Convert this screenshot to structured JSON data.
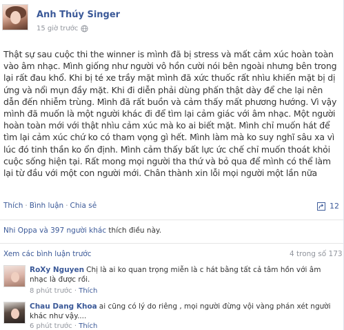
{
  "post": {
    "author": "Anh Thúy Singer",
    "timestamp": "15 giờ trước",
    "text": "Thật sự sau cuộc thi the winner is mình đã bị stress và mất cảm xúc hoàn toàn vào âm nhạc. Mình giống như người vô hồn cười nói bên ngoài nhưng bên trong lại rất đau khổ. Khi bị té xe trầy mặt mình đã xức thuốc rất nhìu khiến mặt bị dị ứng và nổi mụn đầy mặt. Khi đi diễn phải dùng phấn thật dày để che lại nên dẫn đến nhiễm trùng. Mình đã rất buồn và cảm thấy mất phương hướng. Vì vậy mình đã muốn là một người khác đi để tìm lại cảm giác với âm nhạc. Một người hoàn toàn mới với thật nhìu cảm xúc mà ko ai biết mặt. Mình chỉ muốn hát để tìm lại cảm xúc chứ ko có tham vọng gì hết. Mình làm mà ko suy nghĩ sâu xa vì lúc đó tinh thần ko ổn định. Mình cảm thấy bất lực ức chế chỉ muốn thoát khỏi cuộc sống hiện tại. Rất mong mọi người tha thứ và bỏ qua để mình có thể làm lại từ đầu với một con người mới. Chân thành xin lỗi mọi người một lần nữa"
  },
  "actions": {
    "like": "Thích",
    "comment": "Bình luận",
    "share": "Chia sẻ",
    "separator": "·",
    "share_count": "12"
  },
  "likes": {
    "link": "Nhi Oppa và 397 người khác",
    "rest": " thích điều này."
  },
  "comments_section": {
    "view_more": "Xem các bình luận trước",
    "count": "4 trong số 173",
    "items": [
      {
        "author": "RoXy Nguyen",
        "text": "Chị là ai ko quan trọng miễn là c hát bằng tất cả tâm hồn với âm nhạc là được rồi.",
        "time": "8 phút trước",
        "like": "Thích"
      },
      {
        "author": "Chau Dang Khoa",
        "text": "ai cũng có lý do riêng , mọi người đừng vội vàng phán xét người khác như vậy....",
        "time": "6 phút trước",
        "like": "Thích"
      }
    ]
  },
  "icons": {
    "globe": "globe-icon",
    "share": "share-icon"
  },
  "colors": {
    "link": "#3b5998",
    "muted": "#90949c",
    "text": "#333333"
  }
}
